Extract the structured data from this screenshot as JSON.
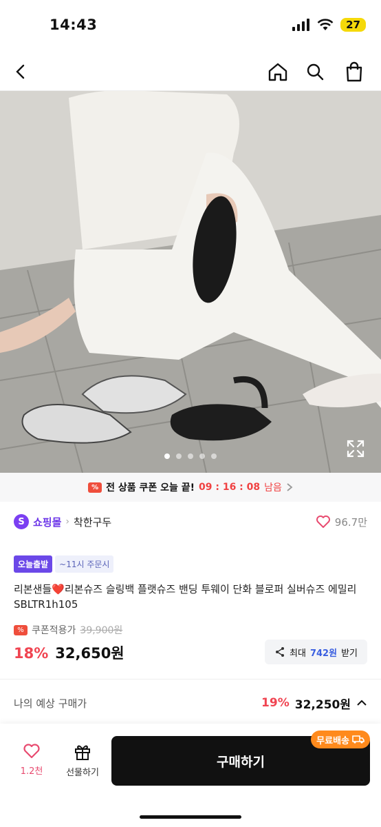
{
  "status": {
    "time": "14:43",
    "battery": "27"
  },
  "nav": {
    "back_icon": "chevron-left-icon",
    "home_icon": "home-icon",
    "search_icon": "search-icon",
    "cart_icon": "shopping-bag-icon"
  },
  "carousel": {
    "total": 5,
    "active_index": 0
  },
  "coupon_banner": {
    "text": "전 상품 쿠폰 오늘 끝!",
    "timer": "09 : 16 : 08",
    "suffix": "남음"
  },
  "store": {
    "badge": "S",
    "shop": "쇼핑몰",
    "brand": "착한구두",
    "likes": "96.7만"
  },
  "tags": {
    "primary": "오늘출발",
    "secondary": "~11시 주문시"
  },
  "product": {
    "title": "리본샌들❤️리본슈즈 슬링백 플랫슈즈 밴딩 투웨이 단화 블로퍼 실버슈즈 에밀리 SBLTR1h105",
    "coupon_label": "쿠폰적용가",
    "original_price": "39,900원",
    "discount": "18%",
    "price": "32,650원",
    "points_prefix": "최대",
    "points": "742원",
    "points_suffix": "받기"
  },
  "estimate": {
    "label": "나의 예상 구매가",
    "discount": "19%",
    "price": "32,250원"
  },
  "bottom": {
    "likes": "1.2천",
    "gift": "선물하기",
    "buy": "구매하기",
    "shipping": "무료배송"
  },
  "colors": {
    "accent": "#6b35e8",
    "sale": "#f04451",
    "buy": "#111111",
    "shipping": "#ff8a1c"
  }
}
